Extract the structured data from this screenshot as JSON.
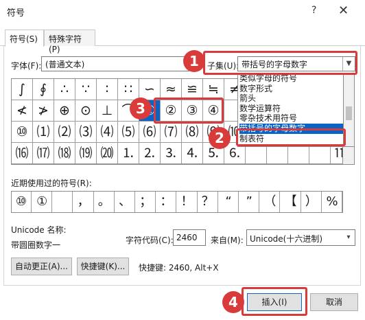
{
  "window": {
    "title": "符号",
    "help": "?",
    "close": "✕"
  },
  "tabs": [
    {
      "label": "符号(S)"
    },
    {
      "label": "特殊字符(P)"
    }
  ],
  "font": {
    "label": "字体(F):",
    "value": "(普通文本)"
  },
  "subset": {
    "label": "子集(U):",
    "value": "带括号的字母数字"
  },
  "subset_list": [
    "类似字母的符号",
    "数字形式",
    "箭头",
    "数学运算符",
    "零杂技术用符号",
    "带括号的字母数字",
    "制表符"
  ],
  "grid_rows": [
    [
      "∫",
      "∮",
      "∴",
      "∵",
      "∶",
      "∷",
      "∽",
      "≈",
      "≌",
      "≒",
      "≠",
      "",
      "",
      "",
      "",
      ""
    ],
    [
      "≮",
      "≯",
      "⊕",
      "⊙",
      "⊥",
      "⌒",
      "①",
      "②",
      "③",
      "④",
      "",
      "",
      "",
      "",
      "",
      ""
    ],
    [
      "⑩",
      "⑴",
      "⑵",
      "⑶",
      "⑷",
      "⑸",
      "⑹",
      "⑺",
      "⑻",
      "⑼",
      "⑽",
      "",
      "",
      "",
      "",
      ""
    ],
    [
      "⒃",
      "⒄",
      "⒅",
      "⒆",
      "⒇",
      "⒈",
      "⒉",
      "⒊",
      "⒋",
      "⒌",
      "⒍",
      "",
      "",
      "",
      "",
      "⒒"
    ]
  ],
  "recent": {
    "label": "近期使用过的符号(R):",
    "symbols": [
      "⑩",
      "①",
      "",
      "，",
      "。",
      "、",
      "；",
      "：",
      "！",
      "？",
      "“",
      "”",
      "（",
      "【",
      "）",
      "%"
    ]
  },
  "unicode": {
    "name_label": "Unicode 名称:",
    "name_value": "带圆圈数字一",
    "code_label": "字符代码(C):",
    "code_value": "2460",
    "from_label": "来自(M):",
    "from_value": "Unicode(十六进制)"
  },
  "buttons": {
    "autocorrect": "自动更正(A)...",
    "shortcut": "快捷键(K)...",
    "shortcut_info": "快捷键: 2460, Alt+X",
    "insert": "插入(I)",
    "cancel": "取消"
  },
  "annotations": [
    "1",
    "2",
    "3",
    "4"
  ],
  "colors": {
    "annotation": "#d93a3a",
    "selection": "#0a64c8"
  }
}
